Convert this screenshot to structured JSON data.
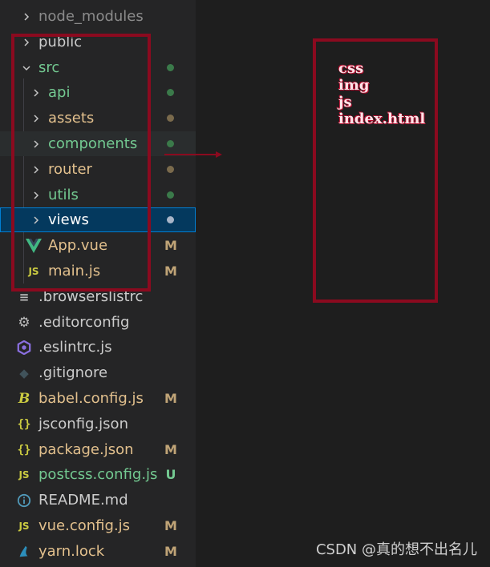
{
  "colors": {
    "modified": "#c0a477",
    "untracked": "#73c991",
    "folder_default": "#cccccc",
    "folder_modified": "#e2c08d",
    "folder_untracked": "#73c991",
    "folder_dim": "#8b8b8b",
    "annotation_red": "#8b0a1f"
  },
  "explorer": {
    "items": [
      {
        "label": "node_modules",
        "kind": "folder",
        "icon": "chevron-right-icon",
        "color": "#8b8b8b"
      },
      {
        "label": "public",
        "kind": "folder",
        "icon": "chevron-right-icon",
        "color": "#cccccc"
      },
      {
        "label": "src",
        "kind": "folder",
        "icon": "chevron-down-icon",
        "color": "#73c991",
        "dot": "#3b7a4a"
      },
      {
        "label": "api",
        "kind": "folder",
        "icon": "chevron-right-icon",
        "color": "#73c991",
        "dot": "#3b7a4a"
      },
      {
        "label": "assets",
        "kind": "folder",
        "icon": "chevron-right-icon",
        "color": "#e2c08d",
        "dot": "#7a6a4c"
      },
      {
        "label": "components",
        "kind": "folder",
        "icon": "chevron-right-icon",
        "color": "#73c991",
        "dot": "#3b7a4a"
      },
      {
        "label": "router",
        "kind": "folder",
        "icon": "chevron-right-icon",
        "color": "#e2c08d",
        "dot": "#7a6a4c"
      },
      {
        "label": "utils",
        "kind": "folder",
        "icon": "chevron-right-icon",
        "color": "#73c991",
        "dot": "#3b7a4a"
      },
      {
        "label": "views",
        "kind": "folder",
        "icon": "chevron-right-icon",
        "color": "#ffffff",
        "dot": "#a8b5c8"
      },
      {
        "label": "App.vue",
        "kind": "file",
        "icon": "vue-icon",
        "color": "#e2c08d",
        "status": "M"
      },
      {
        "label": "main.js",
        "kind": "file",
        "icon": "js-icon",
        "color": "#e2c08d",
        "status": "M"
      },
      {
        "label": ".browserslistrc",
        "kind": "file",
        "icon": "list-icon",
        "color": "#cccccc"
      },
      {
        "label": ".editorconfig",
        "kind": "file",
        "icon": "gear-icon",
        "color": "#cccccc"
      },
      {
        "label": ".eslintrc.js",
        "kind": "file",
        "icon": "eslint-icon",
        "color": "#cccccc"
      },
      {
        "label": ".gitignore",
        "kind": "file",
        "icon": "git-icon",
        "color": "#cccccc"
      },
      {
        "label": "babel.config.js",
        "kind": "file",
        "icon": "babel-icon",
        "color": "#e2c08d",
        "status": "M"
      },
      {
        "label": "jsconfig.json",
        "kind": "file",
        "icon": "json-icon",
        "color": "#cccccc"
      },
      {
        "label": "package.json",
        "kind": "file",
        "icon": "json-icon",
        "color": "#e2c08d",
        "status": "M"
      },
      {
        "label": "postcss.config.js",
        "kind": "file",
        "icon": "js-icon",
        "color": "#73c991",
        "status": "U"
      },
      {
        "label": "README.md",
        "kind": "file",
        "icon": "info-icon",
        "color": "#cccccc"
      },
      {
        "label": "vue.config.js",
        "kind": "file",
        "icon": "js-icon",
        "color": "#e2c08d",
        "status": "M"
      },
      {
        "label": "yarn.lock",
        "kind": "file",
        "icon": "yarn-icon",
        "color": "#e2c08d",
        "status": "M"
      }
    ]
  },
  "dist_listing": [
    "css",
    "img",
    "js",
    "index.html"
  ],
  "watermark": "CSDN @真的想不出名儿"
}
